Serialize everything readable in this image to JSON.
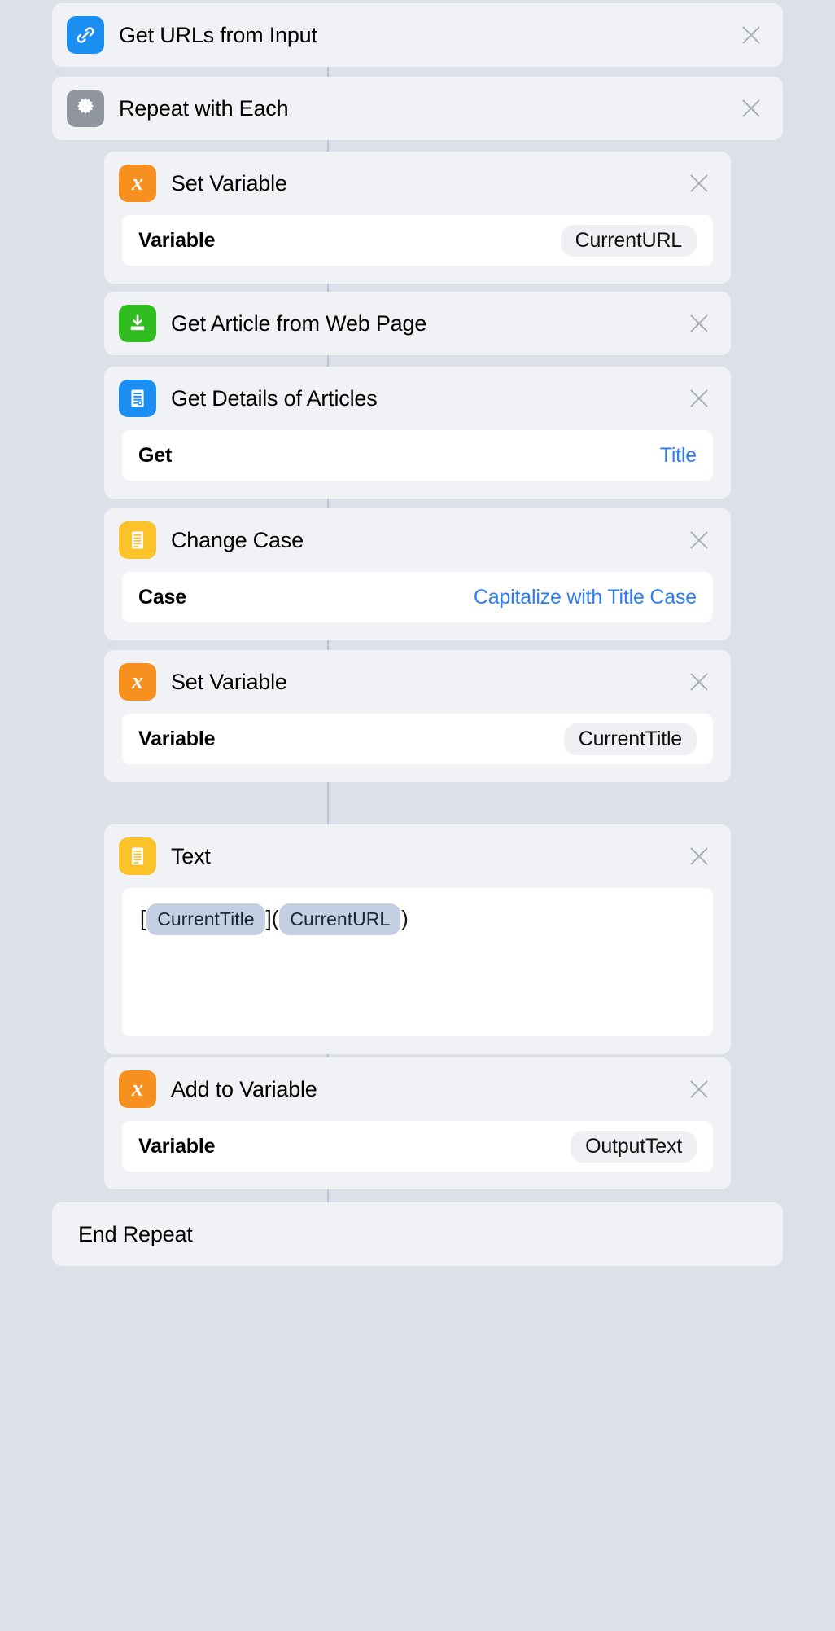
{
  "app": {
    "name": "Shortcuts Workflow Editor",
    "background_color": "#dce1e9",
    "card_color": "#f0f2f6",
    "accent_blue": "#2e7ef0",
    "connector_color": "#b9c3d1"
  },
  "close_icon": "close-icon",
  "actions": [
    {
      "id": "get-urls-from-input",
      "title": "Get URLs from Input",
      "icon": "link-icon",
      "icon_color": "#1b8ef2",
      "nested": false,
      "params": []
    },
    {
      "id": "repeat-with-each",
      "title": "Repeat with Each",
      "icon": "gear-icon",
      "icon_color": "#9096a0",
      "nested": false,
      "params": []
    },
    {
      "id": "set-variable-current-url",
      "title": "Set Variable",
      "icon": "variable-x-icon",
      "icon_color": "#f7901e",
      "nested": true,
      "params": [
        {
          "label": "Variable",
          "value": "CurrentURL",
          "style": "pill"
        }
      ]
    },
    {
      "id": "get-article-from-web-page",
      "title": "Get Article from Web Page",
      "icon": "download-article-icon",
      "icon_color": "#2fbd1f",
      "nested": true,
      "params": []
    },
    {
      "id": "get-details-of-articles",
      "title": "Get Details of Articles",
      "icon": "document-details-icon",
      "icon_color": "#1b8ef2",
      "nested": true,
      "params": [
        {
          "label": "Get",
          "value": "Title",
          "style": "link"
        }
      ]
    },
    {
      "id": "change-case",
      "title": "Change Case",
      "icon": "text-lines-icon",
      "icon_color": "#fcc22a",
      "nested": true,
      "params": [
        {
          "label": "Case",
          "value": "Capitalize with Title Case",
          "style": "link"
        }
      ]
    },
    {
      "id": "set-variable-current-title",
      "title": "Set Variable",
      "icon": "variable-x-icon",
      "icon_color": "#f7901e",
      "nested": true,
      "params": [
        {
          "label": "Variable",
          "value": "CurrentTitle",
          "style": "pill"
        }
      ]
    },
    {
      "id": "text",
      "title": "Text",
      "icon": "text-lines-icon",
      "icon_color": "#fcc22a",
      "nested": true,
      "body": {
        "segments": [
          {
            "type": "text",
            "value": "["
          },
          {
            "type": "variable",
            "value": "CurrentTitle"
          },
          {
            "type": "text",
            "value": "]("
          },
          {
            "type": "variable",
            "value": "CurrentURL"
          },
          {
            "type": "text",
            "value": ")"
          }
        ]
      },
      "params": []
    },
    {
      "id": "add-to-variable-output-text",
      "title": "Add to Variable",
      "icon": "variable-x-icon",
      "icon_color": "#f7901e",
      "nested": true,
      "params": [
        {
          "label": "Variable",
          "value": "OutputText",
          "style": "pill"
        }
      ]
    }
  ],
  "end_repeat": {
    "label": "End Repeat"
  }
}
